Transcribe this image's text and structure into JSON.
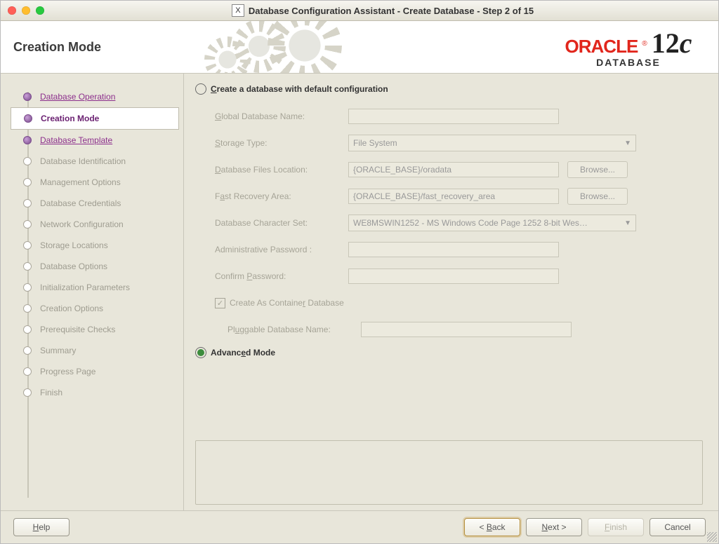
{
  "window": {
    "title": "Database Configuration Assistant - Create Database - Step 2 of 15"
  },
  "header": {
    "page_title": "Creation Mode",
    "brand_word": "ORACLE",
    "brand_version": "12",
    "brand_version_suffix": "c",
    "brand_sub": "DATABASE"
  },
  "sidebar": {
    "items": [
      {
        "label": "Database Operation",
        "state": "done",
        "link": true
      },
      {
        "label": "Creation Mode",
        "state": "now",
        "link": true
      },
      {
        "label": "Database Template",
        "state": "next",
        "link": true
      },
      {
        "label": "Database Identification",
        "state": "dis"
      },
      {
        "label": "Management Options",
        "state": "dis"
      },
      {
        "label": "Database Credentials",
        "state": "dis"
      },
      {
        "label": "Network Configuration",
        "state": "dis"
      },
      {
        "label": "Storage Locations",
        "state": "dis"
      },
      {
        "label": "Database Options",
        "state": "dis"
      },
      {
        "label": "Initialization Parameters",
        "state": "dis"
      },
      {
        "label": "Creation Options",
        "state": "dis"
      },
      {
        "label": "Prerequisite Checks",
        "state": "dis"
      },
      {
        "label": "Summary",
        "state": "dis"
      },
      {
        "label": "Progress Page",
        "state": "dis"
      },
      {
        "label": "Finish",
        "state": "dis"
      }
    ]
  },
  "form": {
    "option_default": "Create a database with default configuration",
    "option_advanced": "Advanced Mode",
    "labels": {
      "gdn": "Global Database Name:",
      "storage": "Storage Type:",
      "files_loc": "Database Files Location:",
      "fra": "Fast Recovery Area:",
      "charset": "Database Character Set:",
      "admin_pw": "Administrative Password :",
      "confirm_pw": "Confirm Password:",
      "cdb": "Create As Container Database",
      "pdb": "Pluggable Database Name:"
    },
    "values": {
      "storage": "File System",
      "files_loc": "{ORACLE_BASE}/oradata",
      "fra": "{ORACLE_BASE}/fast_recovery_area",
      "charset": "WE8MSWIN1252 - MS Windows Code Page 1252 8-bit Wes…"
    },
    "browse": "Browse..."
  },
  "footer": {
    "help": "Help",
    "back": "< Back",
    "next": "Next >",
    "finish": "Finish",
    "cancel": "Cancel"
  }
}
